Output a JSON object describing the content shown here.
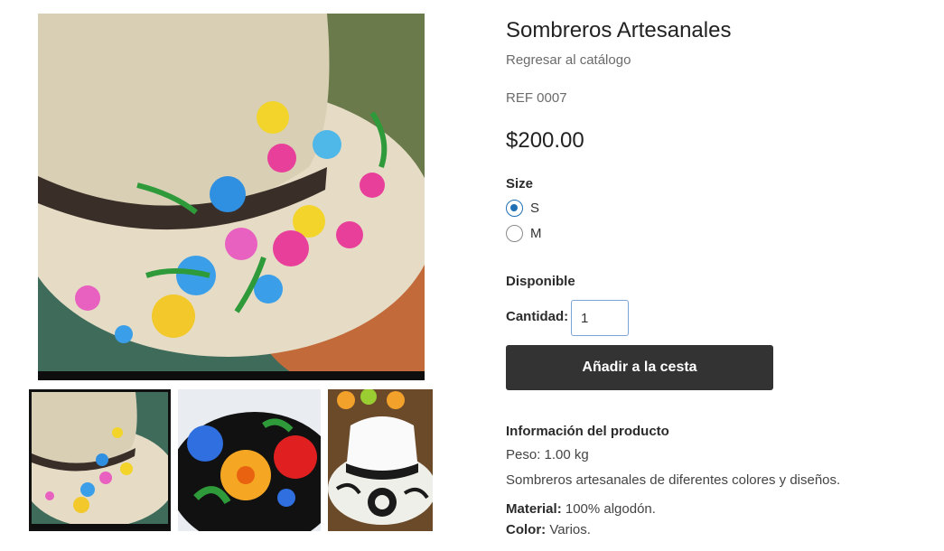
{
  "product": {
    "title": "Sombreros Artesanales",
    "back_link": "Regresar al catálogo",
    "ref": "REF 0007",
    "price": "$200.00"
  },
  "size": {
    "label": "Size",
    "options": [
      {
        "label": "S",
        "selected": true
      },
      {
        "label": "M",
        "selected": false
      }
    ]
  },
  "availability": "Disponible",
  "quantity": {
    "label": "Cantidad:",
    "value": "1"
  },
  "add_to_cart_label": "Añadir a la cesta",
  "details": {
    "heading": "Información del producto",
    "weight": "Peso: 1.00 kg",
    "description": "Sombreros artesanales de diferentes colores y diseños.",
    "material_label": "Material:",
    "material_value": " 100% algodón.",
    "color_label": "Color:",
    "color_value": " Varios."
  },
  "gallery": {
    "selected_index": 0
  },
  "colors": {
    "button_bg": "#333333",
    "radio_accent": "#1f6fb5",
    "input_border": "#7aa6d6"
  }
}
